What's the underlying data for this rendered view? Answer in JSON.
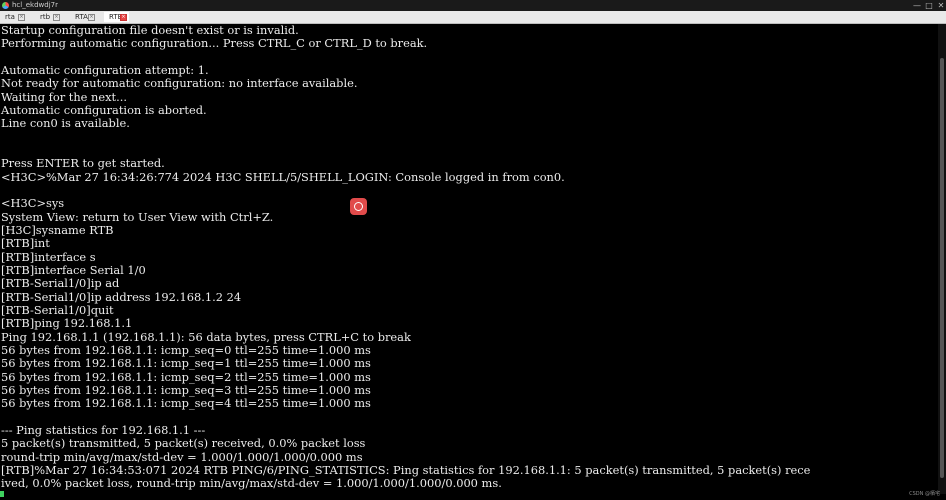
{
  "window": {
    "title": "hcl_ekdwdj7r",
    "controls": {
      "minimize": "—",
      "maximize": "□",
      "close": "✕"
    }
  },
  "tabs": [
    {
      "label": "rta",
      "active": false
    },
    {
      "label": "rtb",
      "active": false
    },
    {
      "label": "RTA",
      "active": false
    },
    {
      "label": "RTB",
      "active": true
    }
  ],
  "tab_close_glyph": "×",
  "terminal": {
    "lines": [
      "Startup configuration file doesn't exist or is invalid.",
      "Performing automatic configuration... Press CTRL_C or CTRL_D to break.",
      "",
      "Automatic configuration attempt: 1.",
      "Not ready for automatic configuration: no interface available.",
      "Waiting for the next...",
      "Automatic configuration is aborted.",
      "Line con0 is available.",
      "",
      "",
      "Press ENTER to get started.",
      "<H3C>%Mar 27 16:34:26:774 2024 H3C SHELL/5/SHELL_LOGIN: Console logged in from con0.",
      "",
      "<H3C>sys",
      "System View: return to User View with Ctrl+Z.",
      "[H3C]sysname RTB",
      "[RTB]int",
      "[RTB]interface s",
      "[RTB]interface Serial 1/0",
      "[RTB-Serial1/0]ip ad",
      "[RTB-Serial1/0]ip address 192.168.1.2 24",
      "[RTB-Serial1/0]quit",
      "[RTB]ping 192.168.1.1",
      "Ping 192.168.1.1 (192.168.1.1): 56 data bytes, press CTRL+C to break",
      "56 bytes from 192.168.1.1: icmp_seq=0 ttl=255 time=1.000 ms",
      "56 bytes from 192.168.1.1: icmp_seq=1 ttl=255 time=1.000 ms",
      "56 bytes from 192.168.1.1: icmp_seq=2 ttl=255 time=1.000 ms",
      "56 bytes from 192.168.1.1: icmp_seq=3 ttl=255 time=1.000 ms",
      "56 bytes from 192.168.1.1: icmp_seq=4 ttl=255 time=1.000 ms",
      "",
      "--- Ping statistics for 192.168.1.1 ---",
      "5 packet(s) transmitted, 5 packet(s) received, 0.0% packet loss",
      "round-trip min/avg/max/std-dev = 1.000/1.000/1.000/0.000 ms",
      "[RTB]%Mar 27 16:34:53:071 2024 RTB PING/6/PING_STATISTICS: Ping statistics for 192.168.1.1: 5 packet(s) transmitted, 5 packet(s) rece",
      "ived, 0.0% packet loss, round-trip min/avg/max/std-dev = 1.000/1.000/1.000/0.000 ms."
    ]
  },
  "icons": {
    "recorder": "screen-recorder-icon",
    "app": "app-logo-icon"
  },
  "watermark": "CSDN @栖宅"
}
